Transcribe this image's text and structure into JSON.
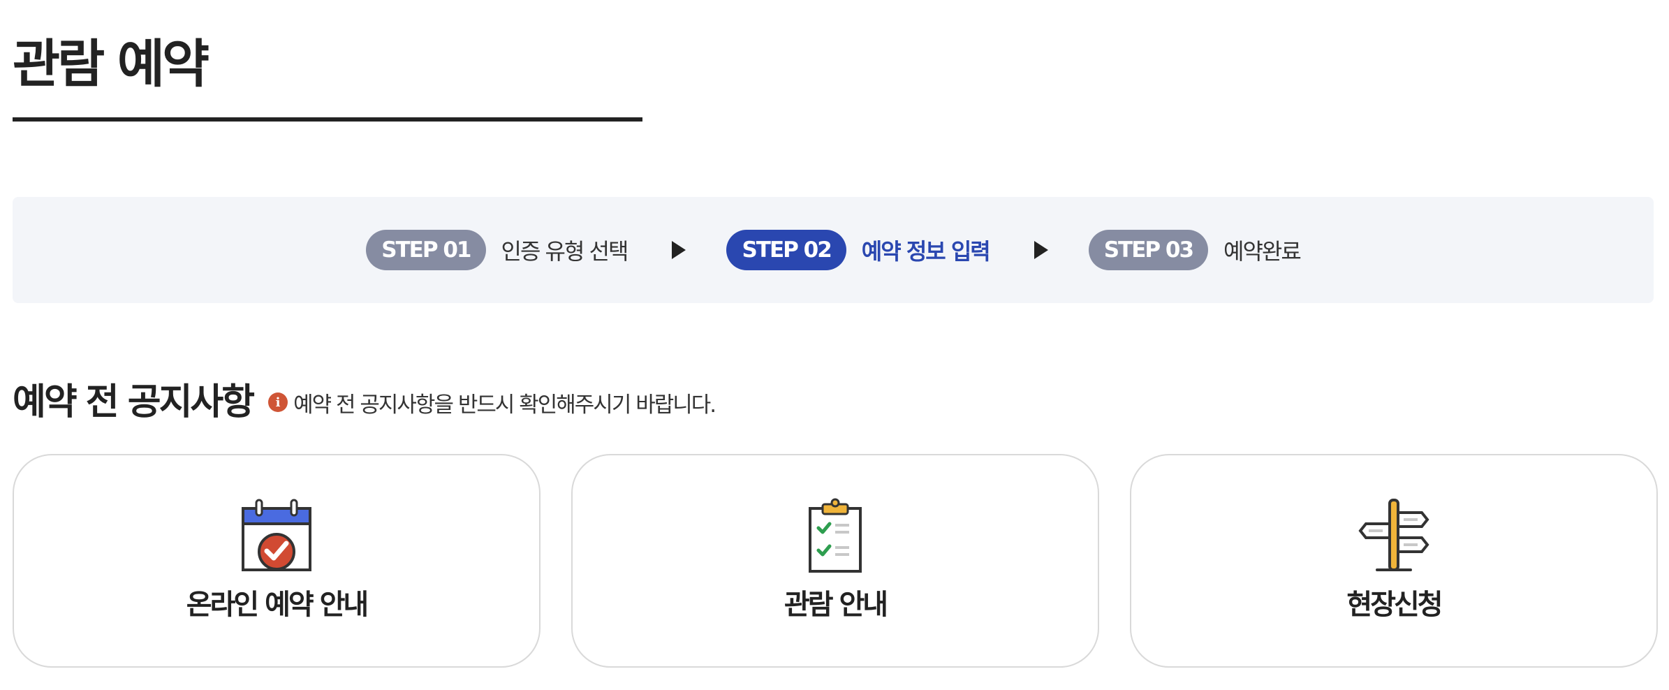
{
  "page": {
    "title": "관람 예약"
  },
  "stepper": {
    "steps": [
      {
        "badge": "STEP 01",
        "label": "인증 유형 선택",
        "active": false
      },
      {
        "badge": "STEP 02",
        "label": "예약 정보 입력",
        "active": true
      },
      {
        "badge": "STEP 03",
        "label": "예약완료",
        "active": false
      }
    ]
  },
  "notice": {
    "title": "예약 전 공지사항",
    "info_icon_glyph": "i",
    "hint": "예약 전 공지사항을 반드시 확인해주시기 바랍니다."
  },
  "cards": [
    {
      "label": "온라인 예약 안내",
      "icon": "calendar-check-icon"
    },
    {
      "label": "관람 안내",
      "icon": "clipboard-checklist-icon"
    },
    {
      "label": "현장신청",
      "icon": "signpost-icon"
    }
  ],
  "colors": {
    "accent": "#2a47b0",
    "inactive_step": "#868ca2",
    "stepper_bg": "#f3f5f9",
    "info_icon": "#cf5536",
    "card_border": "#d9d9d9"
  }
}
